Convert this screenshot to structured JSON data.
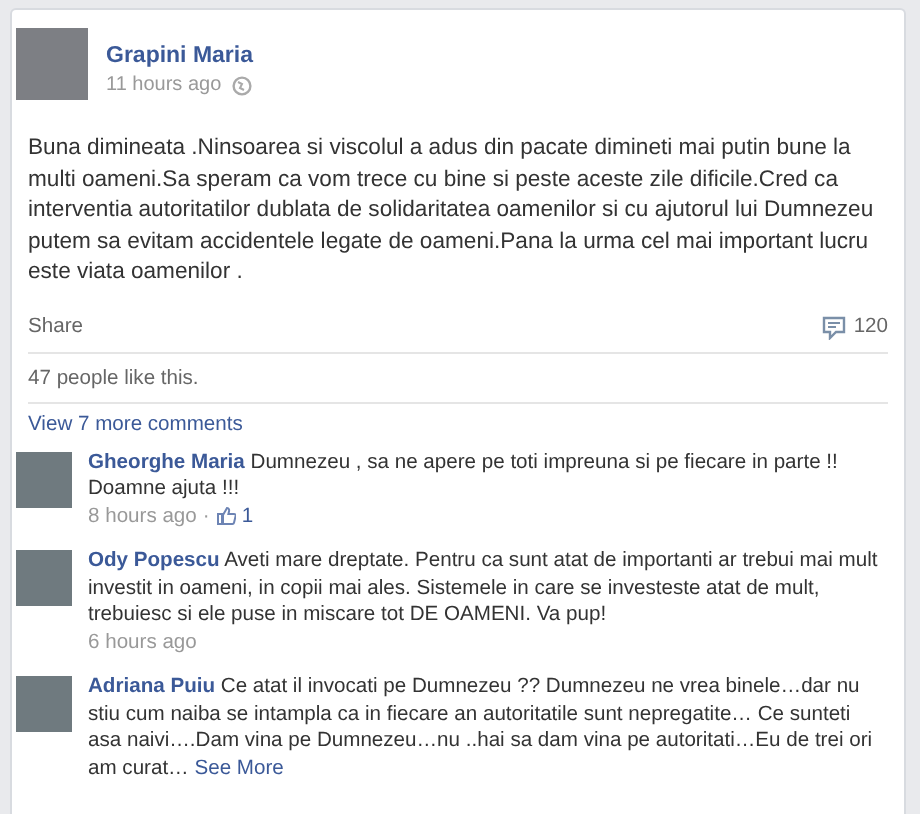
{
  "post": {
    "author": "Grapini Maria",
    "time": "11 hours ago",
    "text": "Buna dimineata .Ninsoarea si viscolul a adus din pacate dimineti mai putin bune la multi oameni.Sa speram ca vom trece cu bine si peste aceste zile dificile.Cred ca interventia autoritatilor dublata de solidaritatea oamenilor si cu ajutorul lui Dumnezeu putem sa evitam accidentele legate de oameni.Pana la urma cel mai important lucru este viata oamenilor ."
  },
  "actions": {
    "share": "Share",
    "comment_count": "120"
  },
  "likes": "47 people like this.",
  "view_more": "View 7 more comments",
  "comments": [
    {
      "author": "Gheorghe Maria",
      "text": "Dumnezeu , sa ne apere pe toti impreuna si pe fiecare in parte !! Doamne ajuta !!!",
      "time": "8 hours ago",
      "separator": "·",
      "likes": "1"
    },
    {
      "author": "Ody Popescu",
      "text": "Aveti mare dreptate. Pentru ca sunt atat de importanti ar trebui mai mult investit in oameni, in copii mai ales. Sistemele in care se investeste atat de mult, trebuiesc si ele puse in miscare tot DE OAMENI. Va pup!",
      "time": "6 hours ago"
    },
    {
      "author": "Adriana Puiu",
      "text": "Ce atat il invocati pe Dumnezeu ?? Dumnezeu ne vrea binele…dar nu stiu cum naiba se intampla ca in fiecare an autoritatile sunt nepregatite… Ce sunteti asa naivi….Dam vina pe Dumnezeu…nu ..hai sa dam vina pe autoritati…Eu de trei ori am curat…",
      "see_more": "See More"
    }
  ]
}
